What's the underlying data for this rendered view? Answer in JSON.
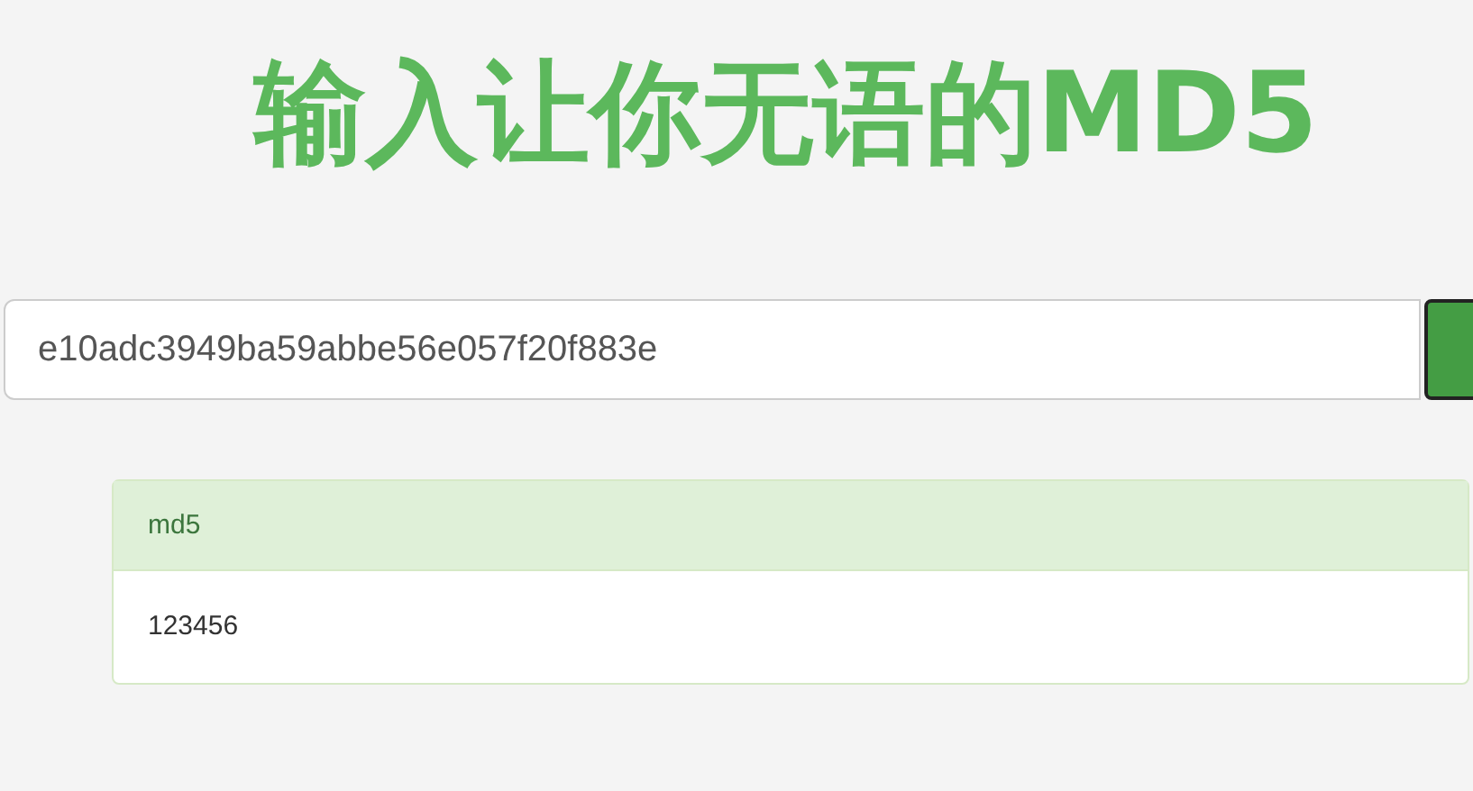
{
  "title": "输入让你无语的MD5",
  "search": {
    "value": "e10adc3949ba59abbe56e057f20f883e"
  },
  "result_panel": {
    "heading": "md5",
    "body": "123456"
  }
}
